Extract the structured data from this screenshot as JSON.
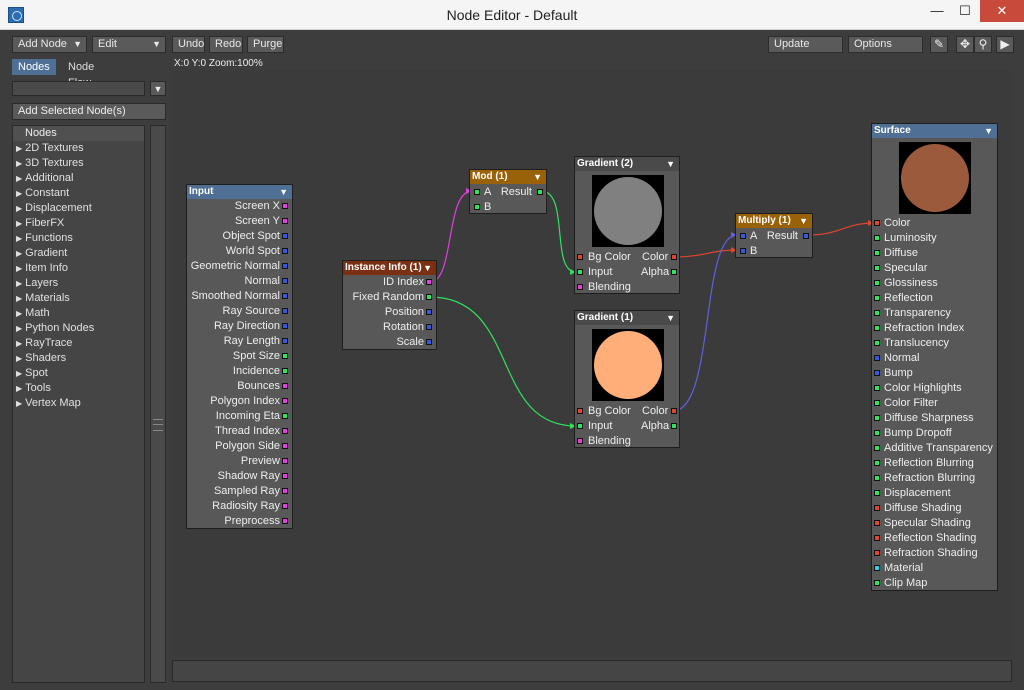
{
  "window": {
    "title": "Node Editor - Default",
    "min": "—",
    "max": "☐",
    "close": "✕"
  },
  "toolbar": {
    "add_node": "Add Node",
    "edit": "Edit",
    "undo": "Undo",
    "redo": "Redo",
    "purge": "Purge",
    "update": "Update",
    "options": "Options"
  },
  "coords_readout": "X:0 Y:0 Zoom:100%",
  "tabs": [
    "Nodes",
    "Node Flow"
  ],
  "add_selected": "Add Selected Node(s)",
  "node_list": {
    "header": "Nodes",
    "items": [
      "2D Textures",
      "3D Textures",
      "Additional",
      "Constant",
      "Displacement",
      "FiberFX",
      "Functions",
      "Gradient",
      "Item Info",
      "Layers",
      "Materials",
      "Math",
      "Python Nodes",
      "RayTrace",
      "Shaders",
      "Spot",
      "Tools",
      "Vertex Map"
    ]
  },
  "nodes": {
    "input": {
      "title": "Input",
      "outputs": [
        {
          "label": "Screen X",
          "color": "#e040e0"
        },
        {
          "label": "Screen Y",
          "color": "#e040e0"
        },
        {
          "label": "Object Spot",
          "color": "#3a55e0"
        },
        {
          "label": "World Spot",
          "color": "#3a55e0"
        },
        {
          "label": "Geometric Normal",
          "color": "#3a55e0"
        },
        {
          "label": "Normal",
          "color": "#3a55e0"
        },
        {
          "label": "Smoothed Normal",
          "color": "#3a55e0"
        },
        {
          "label": "Ray Source",
          "color": "#3a55e0"
        },
        {
          "label": "Ray Direction",
          "color": "#3a55e0"
        },
        {
          "label": "Ray Length",
          "color": "#3a55e0"
        },
        {
          "label": "Spot Size",
          "color": "#30e060"
        },
        {
          "label": "Incidence",
          "color": "#30e060"
        },
        {
          "label": "Bounces",
          "color": "#e040e0"
        },
        {
          "label": "Polygon Index",
          "color": "#e040e0"
        },
        {
          "label": "Incoming Eta",
          "color": "#30e060"
        },
        {
          "label": "Thread Index",
          "color": "#e040e0"
        },
        {
          "label": "Polygon Side",
          "color": "#e040e0"
        },
        {
          "label": "Preview",
          "color": "#e040e0"
        },
        {
          "label": "Shadow Ray",
          "color": "#e040e0"
        },
        {
          "label": "Sampled Ray",
          "color": "#e040e0"
        },
        {
          "label": "Radiosity Ray",
          "color": "#e040e0"
        },
        {
          "label": "Preprocess",
          "color": "#e040e0"
        }
      ]
    },
    "instance_info": {
      "title": "Instance Info (1)",
      "outputs": [
        {
          "label": "ID Index",
          "color": "#e040e0"
        },
        {
          "label": "Fixed Random",
          "color": "#30e060"
        },
        {
          "label": "Position",
          "color": "#3a55e0"
        },
        {
          "label": "Rotation",
          "color": "#3a55e0"
        },
        {
          "label": "Scale",
          "color": "#3a55e0"
        }
      ]
    },
    "mod": {
      "title": "Mod (1)",
      "in_a": "A",
      "in_b": "B",
      "out": "Result"
    },
    "gradient2": {
      "title": "Gradient (2)",
      "bg_color": "Bg Color",
      "input": "Input",
      "blending": "Blending",
      "color": "Color",
      "alpha": "Alpha",
      "ball_color": "#808080"
    },
    "gradient1": {
      "title": "Gradient (1)",
      "bg_color": "Bg Color",
      "input": "Input",
      "blending": "Blending",
      "color": "Color",
      "alpha": "Alpha",
      "ball_color": "#ffae7a"
    },
    "multiply": {
      "title": "Multiply (1)",
      "in_a": "A",
      "in_b": "B",
      "out": "Result"
    },
    "surface": {
      "title": "Surface",
      "ball_color": "#9b5a3c",
      "inputs": [
        {
          "label": "Color",
          "color": "#e04530"
        },
        {
          "label": "Luminosity",
          "color": "#30e060"
        },
        {
          "label": "Diffuse",
          "color": "#30e060"
        },
        {
          "label": "Specular",
          "color": "#30e060"
        },
        {
          "label": "Glossiness",
          "color": "#30e060"
        },
        {
          "label": "Reflection",
          "color": "#30e060"
        },
        {
          "label": "Transparency",
          "color": "#30e060"
        },
        {
          "label": "Refraction Index",
          "color": "#30e060"
        },
        {
          "label": "Translucency",
          "color": "#30e060"
        },
        {
          "label": "Normal",
          "color": "#3a55e0"
        },
        {
          "label": "Bump",
          "color": "#3a55e0"
        },
        {
          "label": "Color Highlights",
          "color": "#30e060"
        },
        {
          "label": "Color Filter",
          "color": "#30e060"
        },
        {
          "label": "Diffuse Sharpness",
          "color": "#30e060"
        },
        {
          "label": "Bump Dropoff",
          "color": "#30e060"
        },
        {
          "label": "Additive Transparency",
          "color": "#30e060"
        },
        {
          "label": "Reflection Blurring",
          "color": "#30e060"
        },
        {
          "label": "Refraction Blurring",
          "color": "#30e060"
        },
        {
          "label": "Displacement",
          "color": "#30e060"
        },
        {
          "label": "Diffuse Shading",
          "color": "#e04530"
        },
        {
          "label": "Specular Shading",
          "color": "#e04530"
        },
        {
          "label": "Reflection Shading",
          "color": "#e04530"
        },
        {
          "label": "Refraction Shading",
          "color": "#e04530"
        },
        {
          "label": "Material",
          "color": "#30d0e0"
        },
        {
          "label": "Clip Map",
          "color": "#30e060"
        }
      ]
    }
  }
}
